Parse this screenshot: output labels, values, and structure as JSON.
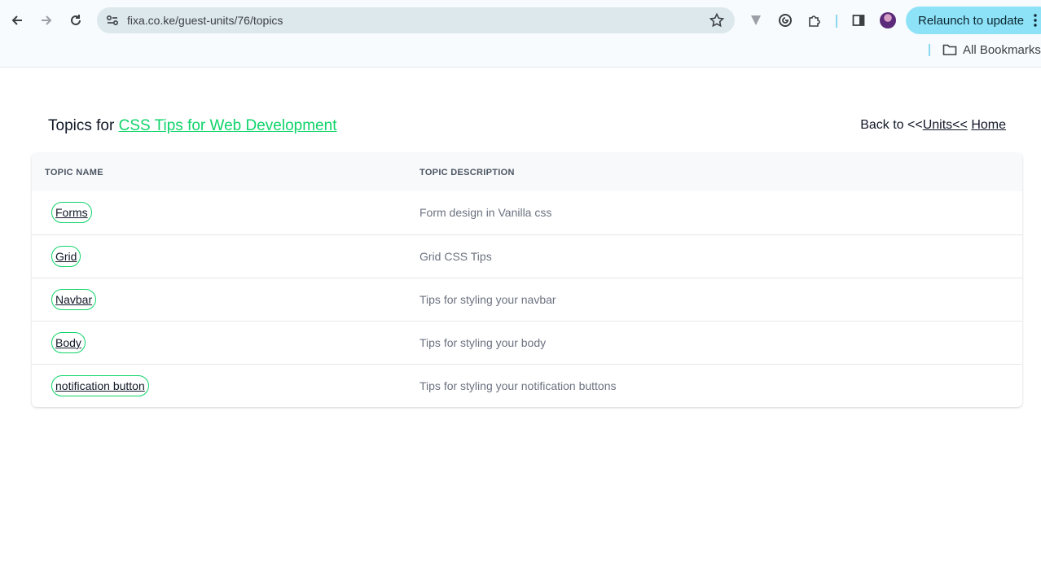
{
  "browser": {
    "url": "fixa.co.ke/guest-units/76/topics",
    "relaunch_label": "Relaunch to update",
    "bookmarks_label": "All Bookmarks",
    "accent_color": "#8ee2f7"
  },
  "page": {
    "heading_prefix": "Topics for",
    "heading_link": "CSS Tips for Web Development",
    "back_prefix": "Back to <<",
    "back_units": "Units<<",
    "back_home": "Home",
    "brand_color": "#10d46a"
  },
  "table": {
    "headers": [
      "TOPIC NAME",
      "TOPIC DESCRIPTION"
    ],
    "rows": [
      {
        "name": "Forms",
        "description": "Form design in Vanilla css"
      },
      {
        "name": "Grid",
        "description": "Grid CSS Tips"
      },
      {
        "name": "Navbar",
        "description": "Tips for styling your navbar"
      },
      {
        "name": "Body",
        "description": "Tips for styling your body"
      },
      {
        "name": "notification button",
        "description": "Tips for styling your notification buttons"
      }
    ]
  }
}
